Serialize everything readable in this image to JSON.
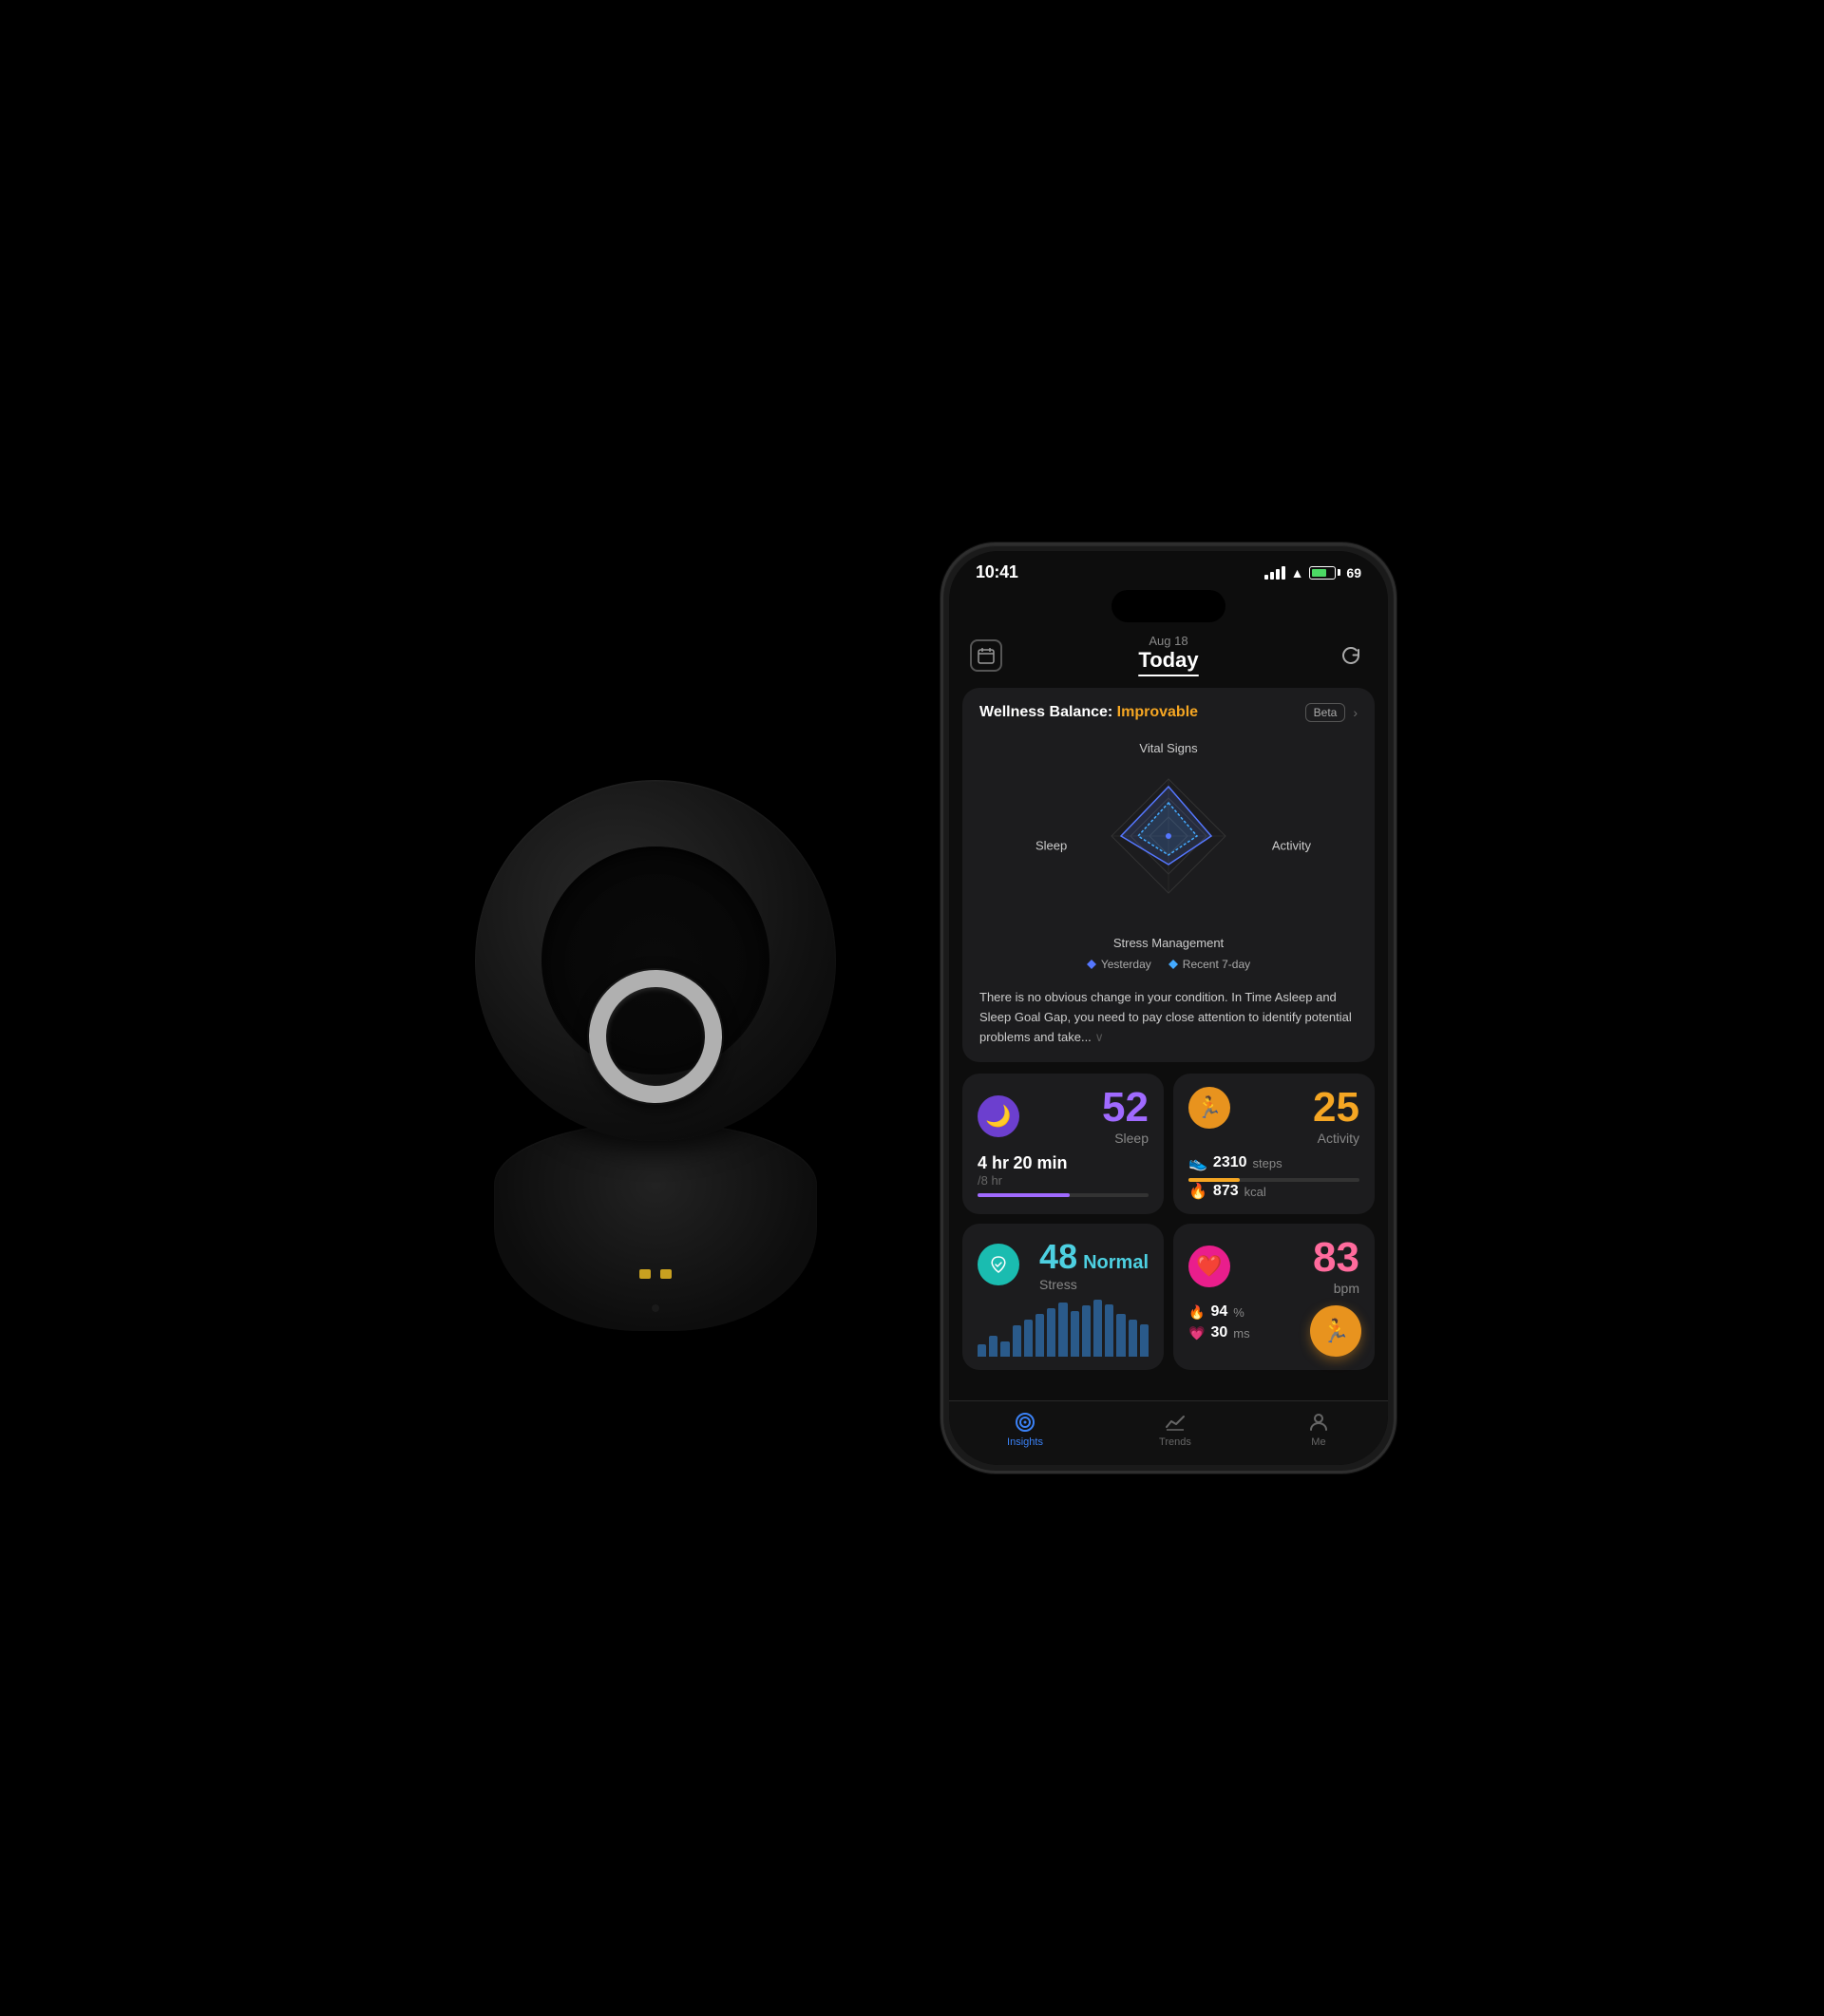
{
  "status_bar": {
    "time": "10:41",
    "battery_pct": "69"
  },
  "header": {
    "date": "Aug 18",
    "title": "Today",
    "calendar_icon": "📅",
    "refresh_icon": "↻"
  },
  "wellness": {
    "title": "Wellness Balance:",
    "status": "Improvable",
    "beta_label": "Beta",
    "radar": {
      "top_label": "Vital Signs",
      "left_label": "Sleep",
      "right_label": "Activity",
      "bottom_label": "Stress Management"
    },
    "legend": {
      "yesterday_label": "Yesterday",
      "recent_label": "Recent 7-day"
    },
    "description": "There is no obvious change in your condition. In Time Asleep and Sleep Goal Gap, you need to pay close attention to identify potential problems and take..."
  },
  "sleep": {
    "score": "52",
    "label": "Sleep",
    "time_hr": "4 hr",
    "time_min": "20 min",
    "goal": "/8 hr",
    "icon": "🌙",
    "progress_pct": 54
  },
  "activity": {
    "score": "25",
    "label": "Activity",
    "steps": "2310",
    "steps_unit": "steps",
    "kcal": "873",
    "kcal_unit": "kcal",
    "icon": "🏃",
    "progress_pct": 30
  },
  "stress": {
    "value": "48",
    "level": "Normal",
    "label": "Stress",
    "icon": "↺",
    "bars": [
      20,
      35,
      25,
      50,
      60,
      70,
      80,
      90,
      75,
      85,
      95,
      88,
      70,
      60,
      55
    ]
  },
  "heart": {
    "bpm": "83",
    "bpm_unit": "bpm",
    "recovery_pct": "94",
    "hrv_ms": "30",
    "hrv_unit": "ms",
    "icon": "❤️"
  },
  "tabs": [
    {
      "label": "Insights",
      "icon": "◎",
      "active": true
    },
    {
      "label": "Trends",
      "icon": "📈",
      "active": false
    },
    {
      "label": "Me",
      "icon": "👤",
      "active": false
    }
  ]
}
